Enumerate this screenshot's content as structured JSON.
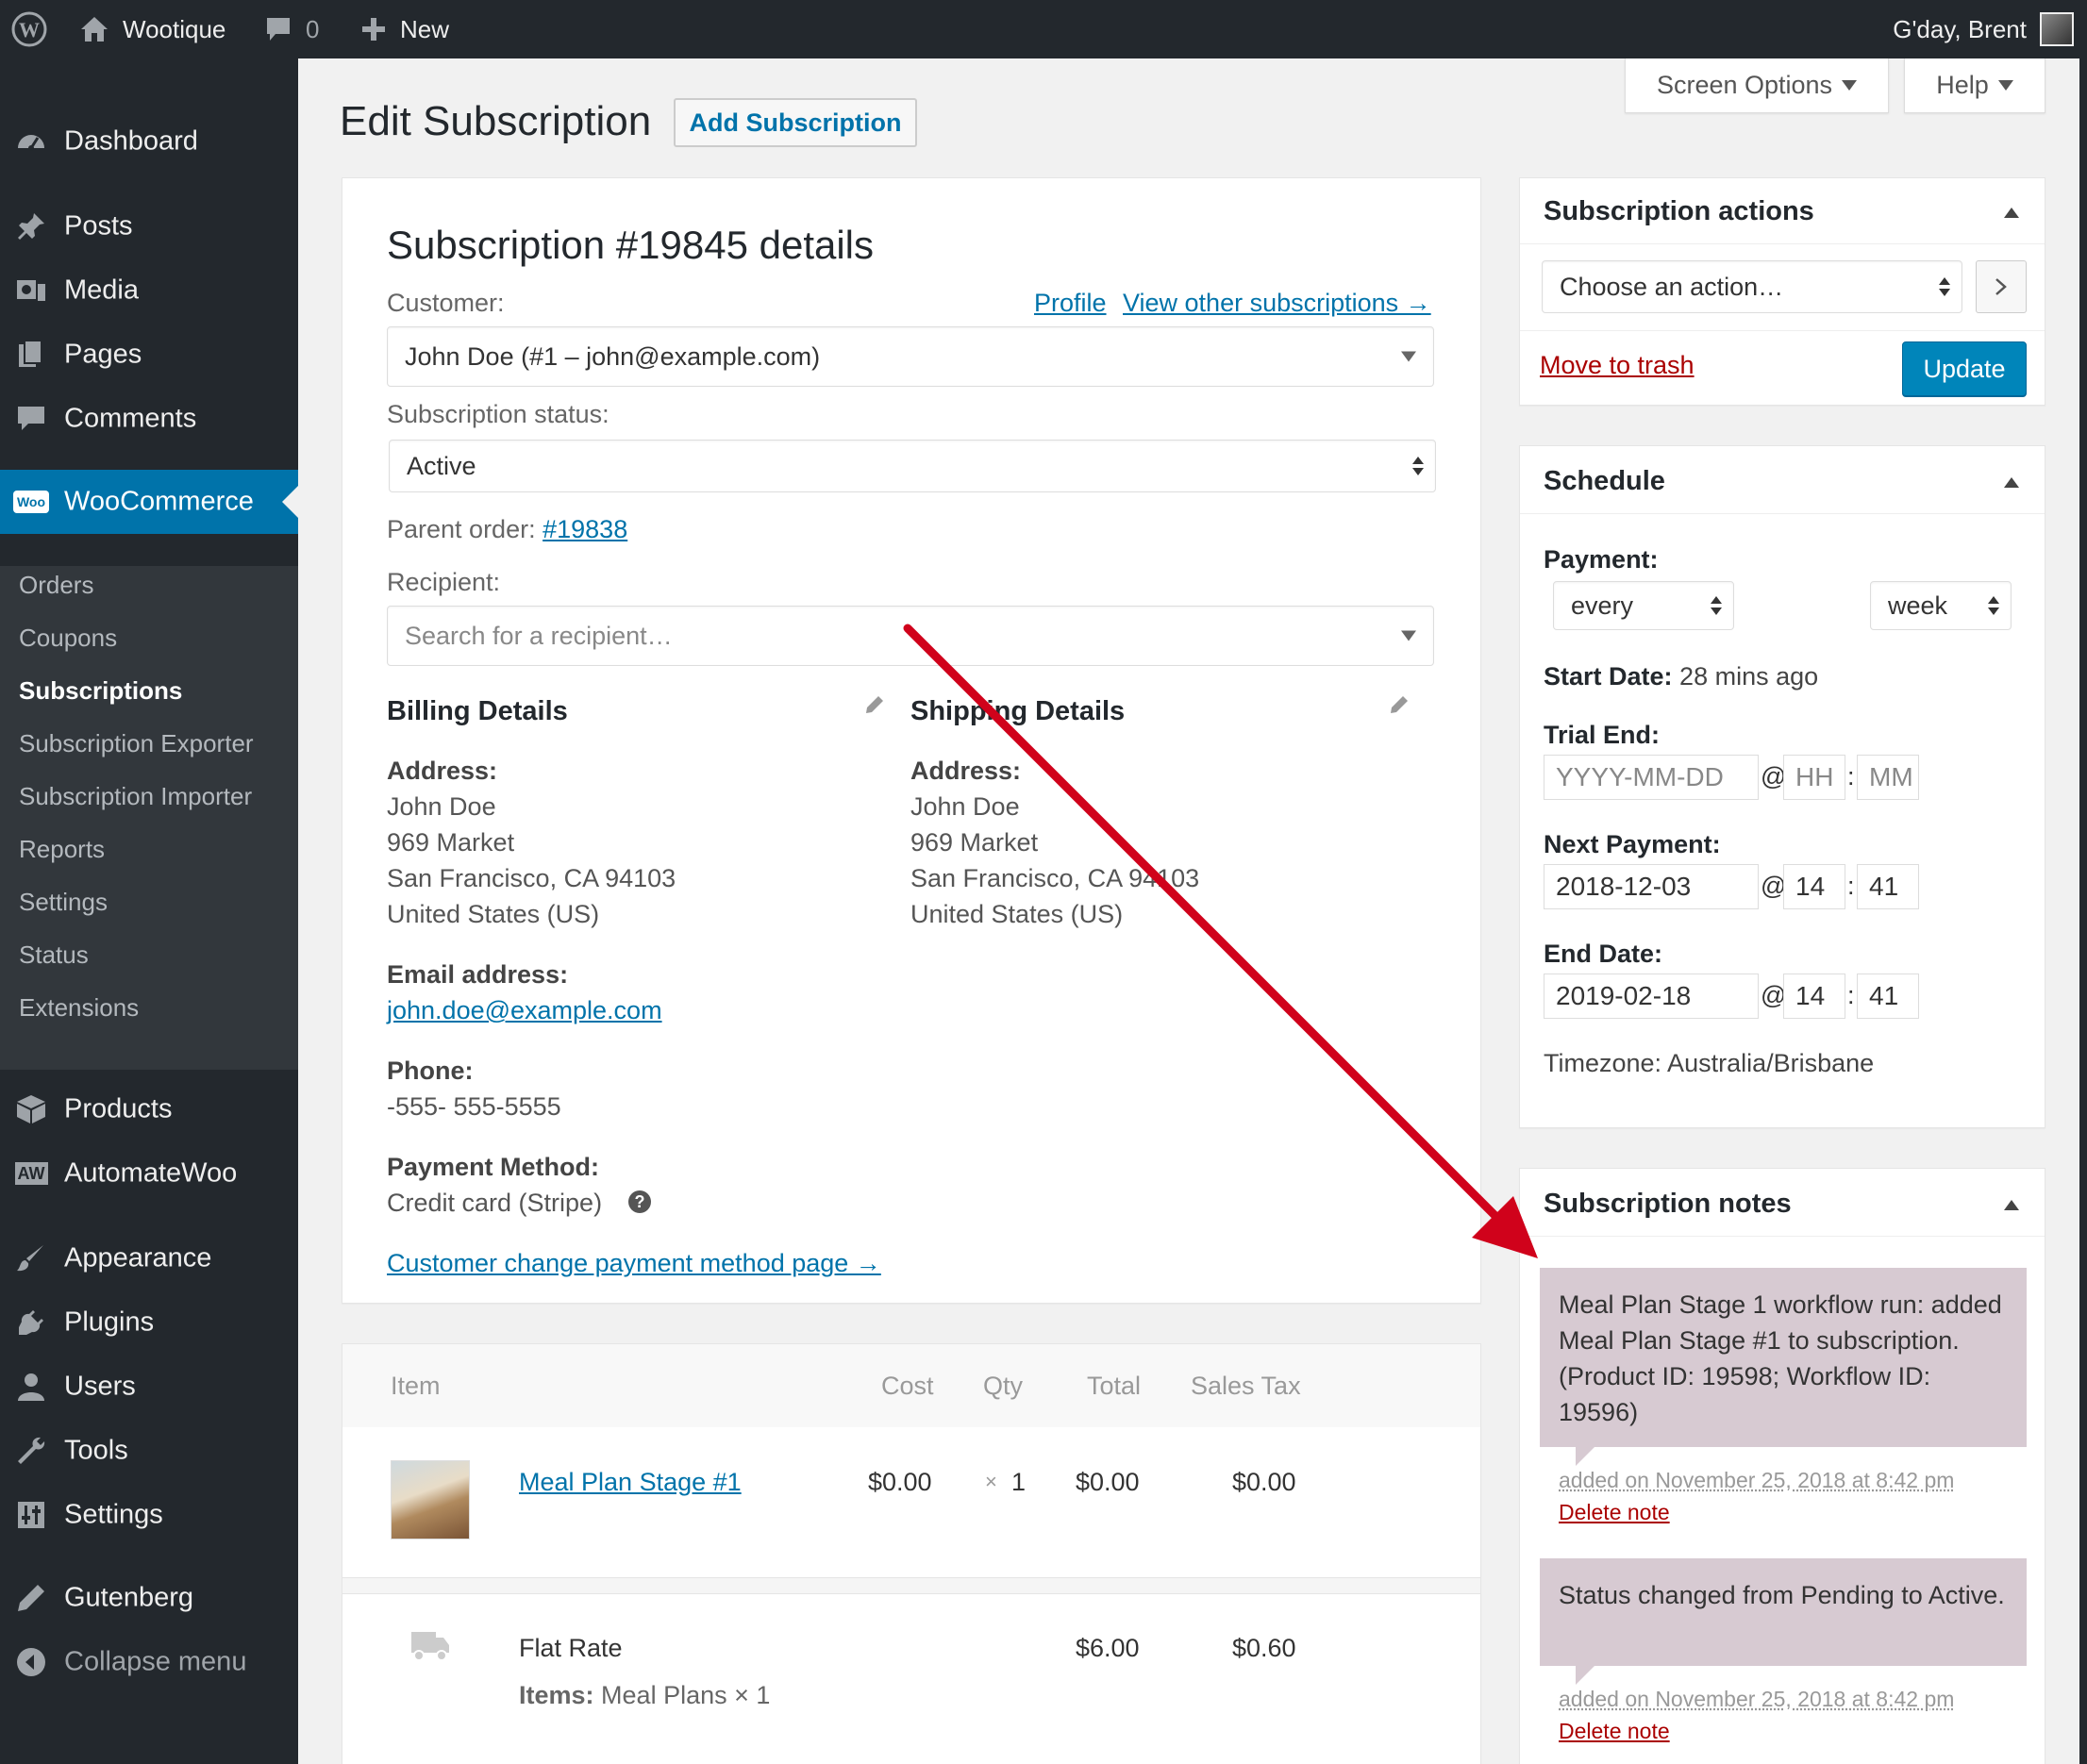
{
  "admin_bar": {
    "site_name": "Wootique",
    "comments_count": "0",
    "new_label": "New",
    "greeting": "G'day, Brent"
  },
  "sidebar": {
    "items": [
      {
        "label": "Dashboard",
        "icon": "dashboard-icon"
      },
      {
        "label": "Posts",
        "icon": "pin-icon"
      },
      {
        "label": "Media",
        "icon": "media-icon"
      },
      {
        "label": "Pages",
        "icon": "pages-icon"
      },
      {
        "label": "Comments",
        "icon": "comment-icon"
      },
      {
        "label": "WooCommerce",
        "icon": "woo-icon"
      },
      {
        "label": "Products",
        "icon": "box-icon"
      },
      {
        "label": "AutomateWoo",
        "icon": "aw-icon"
      },
      {
        "label": "Appearance",
        "icon": "brush-icon"
      },
      {
        "label": "Plugins",
        "icon": "plug-icon"
      },
      {
        "label": "Users",
        "icon": "user-icon"
      },
      {
        "label": "Tools",
        "icon": "wrench-icon"
      },
      {
        "label": "Settings",
        "icon": "sliders-icon"
      },
      {
        "label": "Gutenberg",
        "icon": "pencil-icon"
      },
      {
        "label": "Collapse menu",
        "icon": "collapse-icon"
      }
    ],
    "woo_badge": "Woo",
    "aw_badge": "AW",
    "submenu": [
      "Orders",
      "Coupons",
      "Subscriptions",
      "Subscription Exporter",
      "Subscription Importer",
      "Reports",
      "Settings",
      "Status",
      "Extensions"
    ]
  },
  "header": {
    "screen_options": "Screen Options",
    "help": "Help",
    "page_title": "Edit Subscription",
    "add_button": "Add Subscription"
  },
  "details": {
    "heading": "Subscription #19845 details",
    "customer_label": "Customer:",
    "profile_link": "Profile",
    "other_subs_link": "View other subscriptions →",
    "customer_value": "John Doe (#1 – john@example.com)",
    "status_label": "Subscription status:",
    "status_value": "Active",
    "parent_label": "Parent order:",
    "parent_link": "#19838",
    "recipient_label": "Recipient:",
    "recipient_placeholder": "Search for a recipient…",
    "billing": {
      "title": "Billing Details",
      "address_label": "Address:",
      "address": [
        "John Doe",
        "969 Market",
        "San Francisco, CA 94103",
        "United States (US)"
      ],
      "email_label": "Email address:",
      "email": "john.doe@example.com",
      "phone_label": "Phone:",
      "phone": "-555- 555-5555",
      "payment_label": "Payment Method:",
      "payment": "Credit card (Stripe)",
      "change_link": "Customer change payment method page →"
    },
    "shipping": {
      "title": "Shipping Details",
      "address_label": "Address:",
      "address": [
        "John Doe",
        "969 Market",
        "San Francisco, CA 94103",
        "United States (US)"
      ]
    }
  },
  "items": {
    "headers": {
      "item": "Item",
      "cost": "Cost",
      "qty": "Qty",
      "total": "Total",
      "tax": "Sales Tax"
    },
    "rows": [
      {
        "name": "Meal Plan Stage #1",
        "cost": "$0.00",
        "qty_x": "×",
        "qty": "1",
        "total": "$0.00",
        "tax": "$0.00"
      }
    ],
    "shipping": {
      "name": "Flat Rate",
      "items_label": "Items:",
      "items_value": "Meal Plans × 1",
      "total": "$6.00",
      "tax": "$0.60"
    }
  },
  "actions_box": {
    "title": "Subscription actions",
    "select_value": "Choose an action…",
    "trash": "Move to trash",
    "update": "Update"
  },
  "schedule": {
    "title": "Schedule",
    "payment_label": "Payment:",
    "interval": "every",
    "period": "week",
    "start_label": "Start Date:",
    "start_value": "28 mins ago",
    "trial_label": "Trial End:",
    "trial_date_placeholder": "YYYY-MM-DD",
    "trial_hh": "HH",
    "trial_mm": "MM",
    "next_label": "Next Payment:",
    "next_date": "2018-12-03",
    "next_hh": "14",
    "next_mm": "41",
    "end_label": "End Date:",
    "end_date": "2019-02-18",
    "end_hh": "14",
    "end_mm": "41",
    "at": "@",
    "colon": ":",
    "timezone": "Timezone: Australia/Brisbane"
  },
  "notes": {
    "title": "Subscription notes",
    "items": [
      {
        "text": "Meal Plan Stage 1 workflow run: added Meal Plan Stage #1 to subscription. (Product ID: 19598; Workflow ID: 19596)",
        "meta": "added on November 25, 2018 at 8:42 pm",
        "delete": "Delete note"
      },
      {
        "text": "Status changed from Pending to Active.",
        "meta": "added on November 25, 2018 at 8:42 pm",
        "delete": "Delete note"
      }
    ]
  },
  "colors": {
    "accent": "#0073aa",
    "annotation_arrow": "#d0021b",
    "note_bg": "#d7cad2",
    "sidebar_bg": "#23282d"
  }
}
